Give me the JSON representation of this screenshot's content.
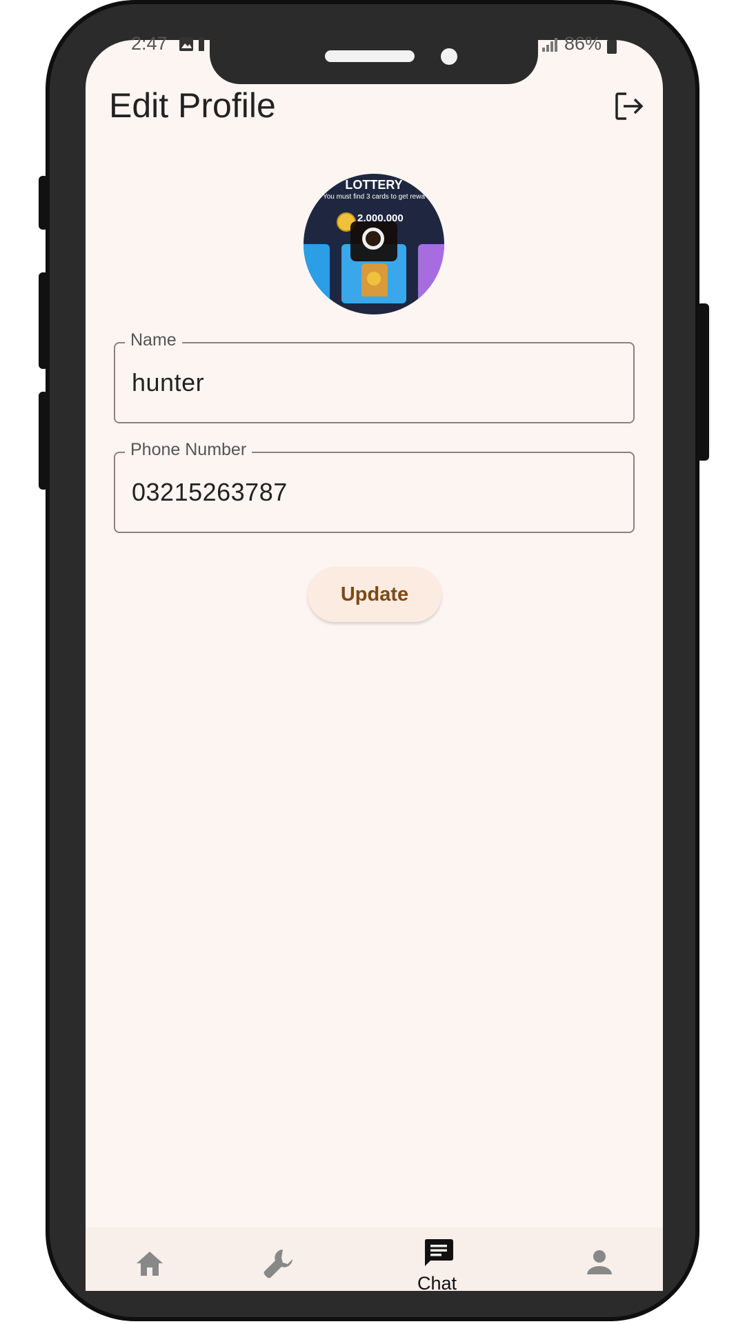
{
  "status_bar": {
    "time": "2:47",
    "battery_text": "86%"
  },
  "header": {
    "title": "Edit Profile",
    "logout_icon": "logout-icon"
  },
  "avatar": {
    "image_title": "LOTTERY",
    "image_subtitle": "You must find 3 cards to get rewa",
    "image_amount": "2,000,000",
    "camera_icon": "camera-icon"
  },
  "form": {
    "name_label": "Name",
    "name_value": "hunter",
    "phone_label": "Phone Number",
    "phone_value": "03215263787",
    "update_label": "Update"
  },
  "bottom_nav": {
    "items": [
      {
        "icon": "home-icon",
        "label": ""
      },
      {
        "icon": "wrench-icon",
        "label": ""
      },
      {
        "icon": "chat-icon",
        "label": "Chat"
      },
      {
        "icon": "person-icon",
        "label": ""
      }
    ]
  },
  "colors": {
    "background": "#fdf5f2",
    "button_bg": "#fcebe0",
    "button_text": "#7a4a18"
  }
}
